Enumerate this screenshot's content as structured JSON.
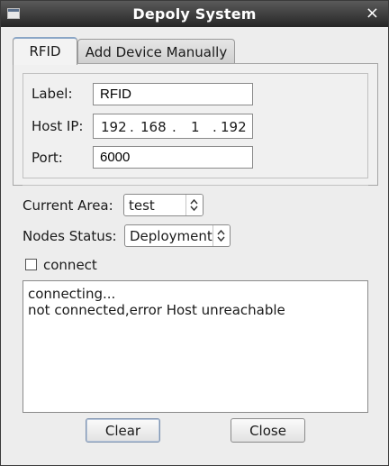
{
  "window": {
    "title": "Depoly System",
    "icon": "app-window-icon",
    "close_glyph": "×"
  },
  "tabs": [
    {
      "label": "RFID",
      "active": true
    },
    {
      "label": "Add Device Manually",
      "active": false
    }
  ],
  "form": {
    "label_caption": "Label:",
    "label_value": "RFID",
    "host_caption": "Host IP:",
    "ip": [
      "192",
      "168",
      "1",
      "192"
    ],
    "ip_dot": ".",
    "port_caption": "Port:",
    "port_value": "6000"
  },
  "area": {
    "caption": "Current Area:",
    "value": "test"
  },
  "nodes": {
    "caption": "Nodes Status:",
    "value": "Deployment"
  },
  "connect": {
    "label": "connect",
    "checked": false
  },
  "log": {
    "lines": [
      "connecting...",
      "not connected,error Host unreachable"
    ]
  },
  "buttons": {
    "clear": "Clear",
    "close": "Close"
  }
}
